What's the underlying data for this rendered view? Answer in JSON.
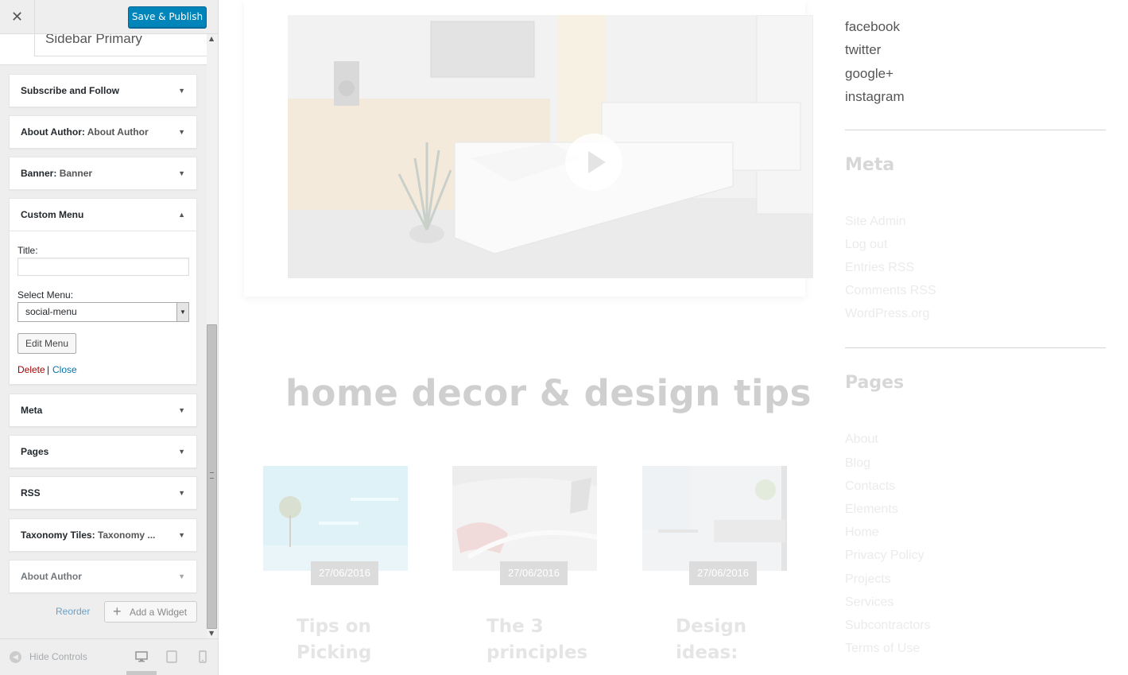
{
  "header": {
    "save_label": "Save & Publish",
    "close_glyph": "✕"
  },
  "section": {
    "title": "Sidebar Primary"
  },
  "widgets": [
    {
      "name": "Subscribe and Follow",
      "sub": ""
    },
    {
      "name": "About Author:",
      "sub": "About Author"
    },
    {
      "name": "Banner:",
      "sub": "Banner"
    },
    {
      "name": "Custom Menu",
      "sub": ""
    },
    {
      "name": "Meta",
      "sub": ""
    },
    {
      "name": "Pages",
      "sub": ""
    },
    {
      "name": "RSS",
      "sub": ""
    },
    {
      "name": "Taxonomy Tiles:",
      "sub": "Taxonomy ..."
    },
    {
      "name": "About Author",
      "sub": ""
    }
  ],
  "custom_menu": {
    "title_label": "Title:",
    "title_value": "",
    "select_label": "Select Menu:",
    "select_value": "social-menu",
    "edit_button": "Edit Menu",
    "delete_link": "Delete",
    "separator": "|",
    "close_link": "Close"
  },
  "actions": {
    "reorder": "Reorder",
    "add_widget": "Add a Widget",
    "plus_glyph": "+"
  },
  "footer": {
    "hide_controls": "Hide Controls"
  },
  "preview": {
    "heading": "home decor & design tips",
    "posts": [
      {
        "date": "27/06/2016",
        "title_lines": [
          "Tips on",
          "Picking"
        ]
      },
      {
        "date": "27/06/2016",
        "title_lines": [
          "The 3",
          "principles"
        ]
      },
      {
        "date": "27/06/2016",
        "title_lines": [
          "Design",
          "ideas:"
        ]
      }
    ],
    "social_links": [
      "facebook",
      "twitter",
      "google+",
      "instagram"
    ],
    "meta_heading": "Meta",
    "meta_links": [
      "Site Admin",
      "Log out",
      "Entries RSS",
      "Comments RSS",
      "WordPress.org"
    ],
    "pages_heading": "Pages",
    "pages_links": [
      "About",
      "Blog",
      "Contacts",
      "Elements",
      "Home",
      "Privacy Policy",
      "Projects",
      "Services",
      "Subcontractors",
      "Terms of Use"
    ]
  },
  "colors": {
    "primary_button": "#0085ba",
    "delete": "#aa0000",
    "link": "#0073aa"
  }
}
